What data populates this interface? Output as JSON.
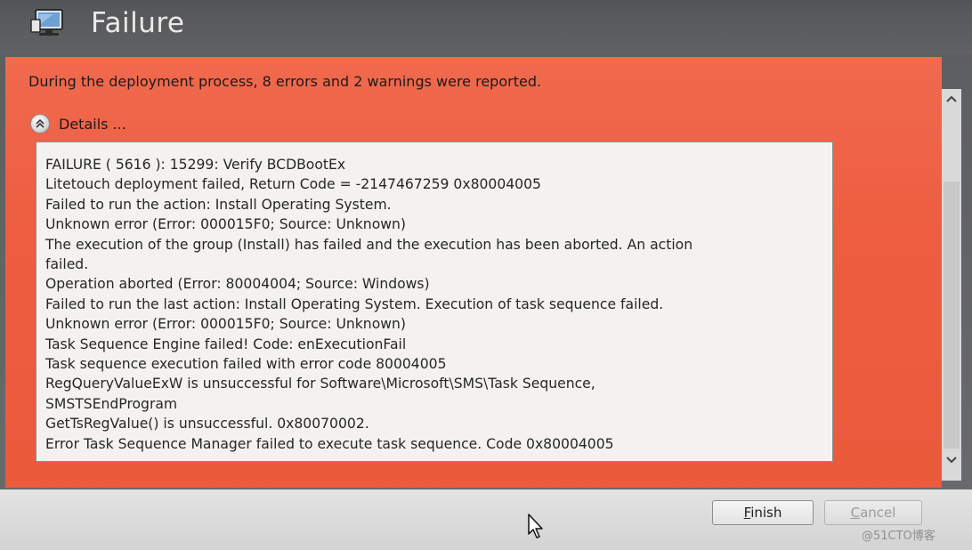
{
  "window": {
    "title": "Failure",
    "title_icon": "computer-monitor-icon"
  },
  "summary": {
    "message": "During the deployment process, 8 errors and 2 warnings were reported."
  },
  "details": {
    "toggle_label": "Details ...",
    "toggle_icon": "collapse-chevrons-icon",
    "lines": [
      "FAILURE ( 5616 ): 15299: Verify BCDBootEx",
      "Litetouch deployment failed, Return Code = -2147467259  0x80004005",
      "Failed to run the action: Install Operating System.",
      "Unknown error (Error: 000015F0; Source: Unknown)",
      "The execution of the group (Install) has failed and the execution has been aborted. An action",
      "failed.",
      "Operation aborted (Error: 80004004; Source: Windows)",
      "Failed to run the last action: Install Operating System. Execution of task sequence failed.",
      "Unknown error (Error: 000015F0; Source: Unknown)",
      "Task Sequence Engine failed! Code: enExecutionFail",
      "Task sequence execution failed with error code 80004005",
      "RegQueryValueExW is unsuccessful for Software\\Microsoft\\SMS\\Task Sequence,",
      "SMSTSEndProgram",
      "GetTsRegValue() is unsuccessful. 0x80070002.",
      "Error Task Sequence Manager failed to execute task sequence. Code 0x80004005"
    ]
  },
  "buttons": {
    "finish": "Finish",
    "cancel": "Cancel"
  },
  "watermark": "@51CTO博客",
  "colors": {
    "panel_bg": "#ee5d40",
    "titlebar_bg": "#5a5b5d",
    "details_bg": "#f4f2ef",
    "bottombar_bg": "#dcdcdc"
  }
}
